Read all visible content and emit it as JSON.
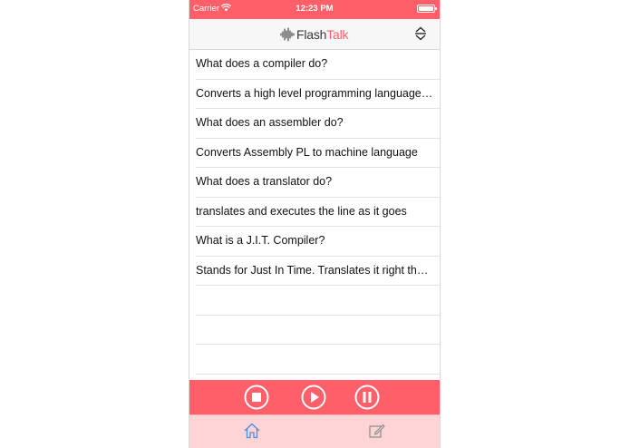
{
  "status_bar": {
    "carrier": "Carrier",
    "time": "12:23 PM"
  },
  "nav": {
    "logo_part1": "Flash",
    "logo_part2": "Talk",
    "sort_icon": "sort-arrows-icon"
  },
  "list": [
    "What does a compiler do?",
    "Converts a high level programming language to machine code",
    "What does an assembler do?",
    "Converts Assembly PL to machine language",
    "What does a translator do?",
    "translates and executes the line as it goes",
    "What is a J.I.T. Compiler?",
    "Stands for Just In Time. Translates it right the moment it is needed",
    "",
    "",
    ""
  ],
  "player": {
    "icons": [
      "stop-icon",
      "play-icon",
      "pause-icon"
    ]
  },
  "tabs": {
    "icons": [
      "home-icon",
      "compose-icon"
    ]
  },
  "colors": {
    "accent": "#ff5f69",
    "tab_bar": "#ffd4d7",
    "nav_bg": "#f7f7f7"
  }
}
